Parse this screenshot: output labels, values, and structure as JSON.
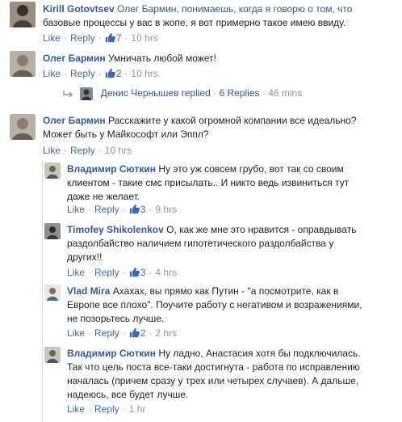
{
  "comments": [
    {
      "author": "Kirill Gotovtsev",
      "text_line1": "Олег Бармин, понимаешь, когда я говорю о том, что",
      "text_line2": "базовые процессы у вас в жопе, я вот примерно такое имею ввиду.",
      "like": "Like",
      "reply": "Reply",
      "likes": "7",
      "time": "10 hrs"
    },
    {
      "author": "Олег Бармин",
      "text_line1": "Умничать любой может!",
      "like": "Like",
      "reply": "Reply",
      "likes": "2",
      "time": "10 hrs",
      "reply_summary": {
        "who": "Денис Чернышев replied",
        "sep": "·",
        "count": "6 Replies",
        "time": "46 mins"
      }
    },
    {
      "author": "Олег Бармин",
      "text_line1": "Расскажите у какой огромной компании все идеально?",
      "text_line2": "Может быть у Майкософт или Эппл?",
      "like": "Like",
      "reply": "Reply",
      "time": "10 hrs"
    }
  ],
  "replies": [
    {
      "author": "Владимир Сюткин",
      "text_line1": "Ну это уж совсем грубо, вот так со своим",
      "text_line2": "клиентом - такие смс присылать.. И никто ведь извиниться тут",
      "text_line3": "даже не желает.",
      "like": "Like",
      "reply": "Reply",
      "likes": "3",
      "time": "9 hrs"
    },
    {
      "author": "Timofey Shikolenkov",
      "text_line1": "О, как же мне это нравится - оправдывать",
      "text_line2": "раздолбайство наличием гипотетического раздолбайства у",
      "text_line3": "других!!",
      "like": "Like",
      "reply": "Reply",
      "likes": "3",
      "time": "4 hrs"
    },
    {
      "author": "Vlad Mira",
      "text_line1": "Ахахах, вы прямо как Путин - \"а посмотрите, как в",
      "text_line2": "Европе все плохо\". Поучите работу с негативом и возражениями,",
      "text_line3": "не позорьтесь лучше.",
      "like": "Like",
      "reply": "Reply",
      "likes": "2",
      "time": "2 hrs"
    },
    {
      "author": "Владимир Сюткин",
      "text_line1": "Ну ладно, Анастасия хотя бы подключилась.",
      "text_line2": "Так что цель поста все-таки достигнута - работа по исправлению",
      "text_line3": "началась (причем сразу у трех или четырех случаев). А дальше,",
      "text_line4": "надеюсь, все будет лучше.",
      "like": "Like",
      "reply": "Reply",
      "time": "1 hr"
    }
  ],
  "ui": {
    "dot": "·"
  },
  "colors": {
    "link": "#365899",
    "action": "#4267b2",
    "muted": "#90949c",
    "text": "#1d2129",
    "like_icon": "#4267b2"
  }
}
